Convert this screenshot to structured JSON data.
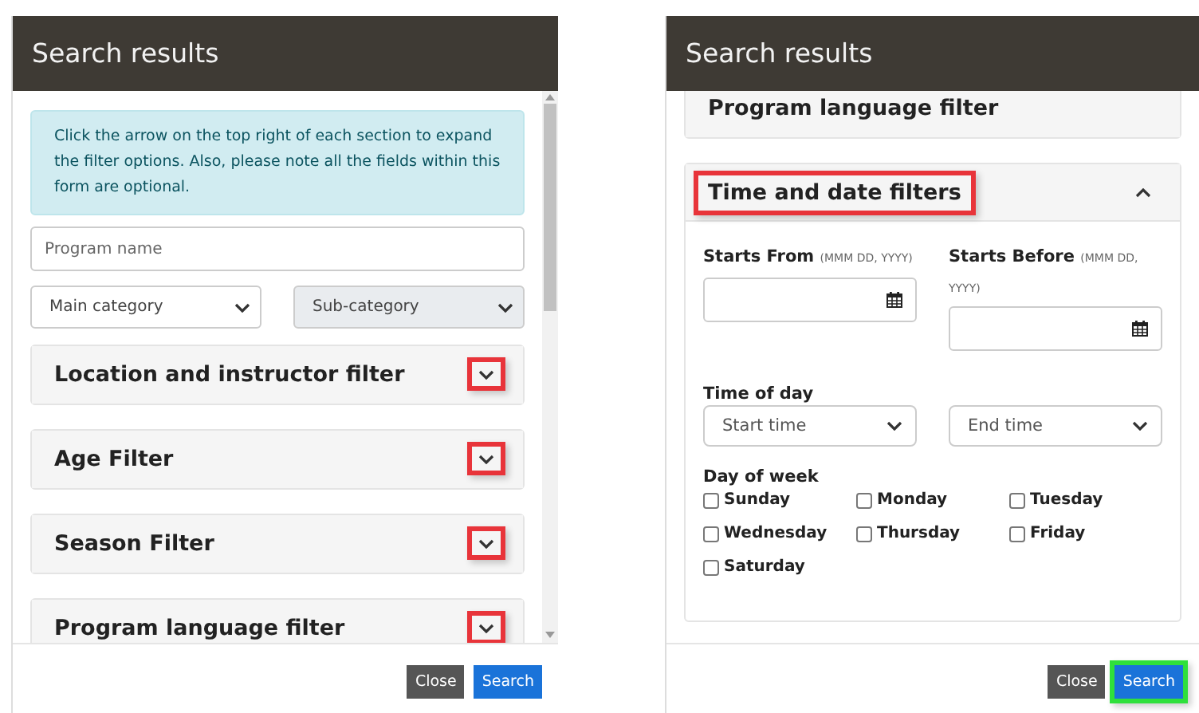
{
  "panels": [
    {
      "title": "Search results",
      "scrollbar": true,
      "notice": "Click the arrow on the top right of each section to expand the filter options. Also, please note all the fields within this form are optional.",
      "program_name": {
        "placeholder": "Program name"
      },
      "categories": [
        {
          "placeholder": "Main category",
          "disabled": false
        },
        {
          "placeholder": "Sub-category",
          "disabled": true
        }
      ],
      "sections": [
        {
          "title": "Location and instructor filter",
          "expanded": false,
          "toggle_highlighted": true,
          "title_highlighted": false,
          "partially_hidden": false
        },
        {
          "title": "Age Filter",
          "expanded": false,
          "toggle_highlighted": true,
          "title_highlighted": false,
          "partially_hidden": false
        },
        {
          "title": "Season Filter",
          "expanded": false,
          "toggle_highlighted": true,
          "title_highlighted": false,
          "partially_hidden": false
        },
        {
          "title": "Program language filter",
          "expanded": false,
          "toggle_highlighted": true,
          "title_highlighted": false,
          "partially_hidden": false
        }
      ],
      "buttons": [
        {
          "label": "Close",
          "kind": "secondary",
          "highlighted": false
        },
        {
          "label": "Search",
          "kind": "primary",
          "highlighted": false
        }
      ]
    },
    {
      "title": "Search results",
      "scrollbar": false,
      "sections": [
        {
          "title": "Program language filter",
          "partially_hidden": true
        },
        {
          "title": "Time and date filters",
          "expanded": true,
          "toggle_highlighted": false,
          "title_highlighted": true,
          "partially_hidden": false,
          "body": {
            "date_fields": [
              {
                "label": "Starts From",
                "hint": "(MMM DD, YYYY)"
              },
              {
                "label": "Starts Before",
                "hint": "(MMM DD, YYYY)"
              }
            ],
            "time_label": "Time of day",
            "time_selects": [
              {
                "placeholder": "Start time"
              },
              {
                "placeholder": "End time"
              }
            ],
            "days_label": "Day of week",
            "days": [
              {
                "label": "Sunday",
                "checked": false
              },
              {
                "label": "Monday",
                "checked": false
              },
              {
                "label": "Tuesday",
                "checked": false
              },
              {
                "label": "Wednesday",
                "checked": false
              },
              {
                "label": "Thursday",
                "checked": false
              },
              {
                "label": "Friday",
                "checked": false
              },
              {
                "label": "Saturday",
                "checked": false
              }
            ]
          }
        }
      ],
      "buttons": [
        {
          "label": "Close",
          "kind": "secondary",
          "highlighted": false
        },
        {
          "label": "Search",
          "kind": "primary",
          "highlighted": true
        }
      ]
    }
  ]
}
